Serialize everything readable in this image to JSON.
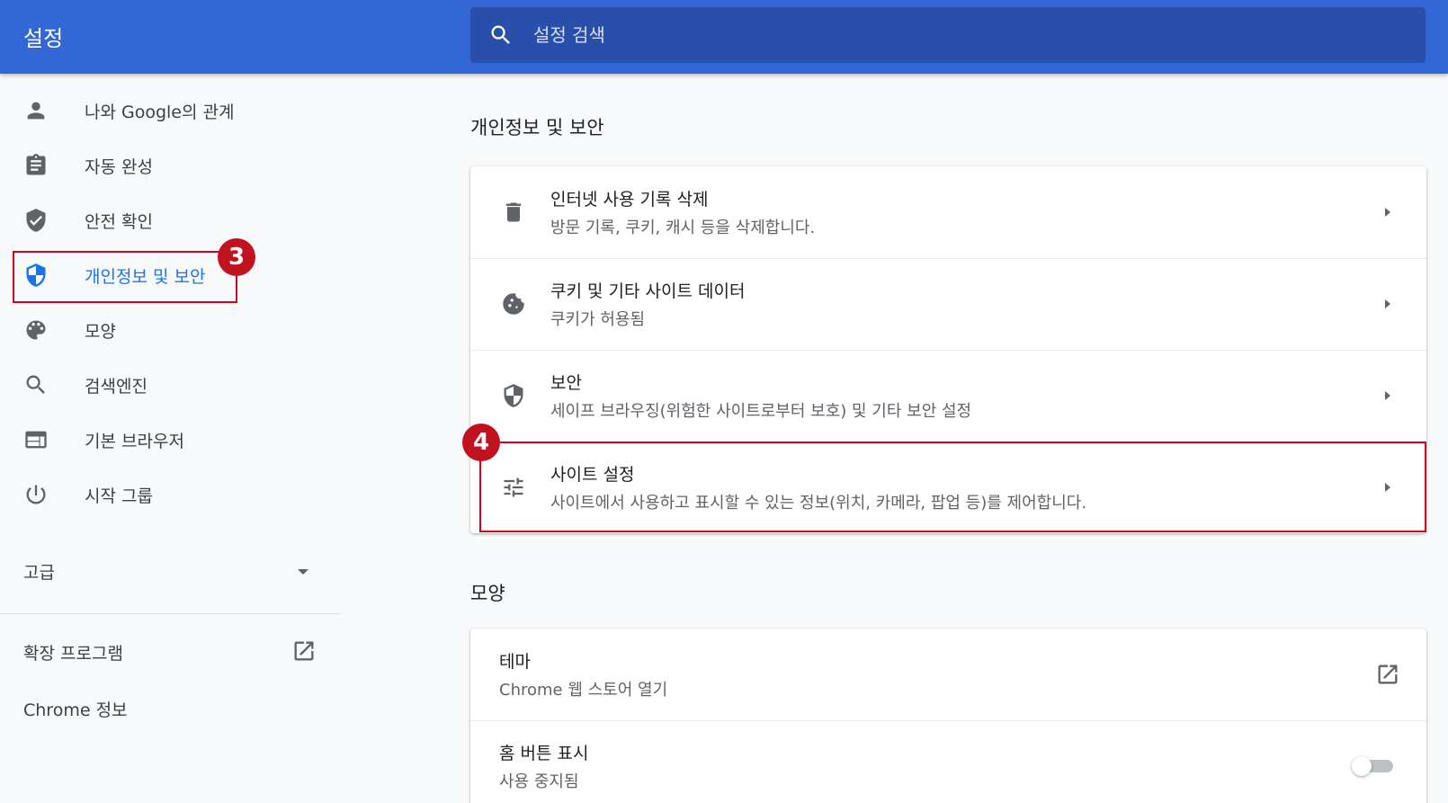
{
  "header": {
    "title": "설정",
    "search_placeholder": "설정 검색",
    "search_icon": "search-icon",
    "bar_color": "#3367d6",
    "search_bg": "#2a4faa"
  },
  "sidebar": {
    "items": [
      {
        "label": "나와 Google의 관계",
        "icon": "person-icon"
      },
      {
        "label": "자동 완성",
        "icon": "clipboard-icon"
      },
      {
        "label": "안전 확인",
        "icon": "shield-check-icon"
      },
      {
        "label": "개인정보 및 보안",
        "icon": "shield-privacy-icon",
        "active": true
      },
      {
        "label": "모양",
        "icon": "palette-icon"
      },
      {
        "label": "검색엔진",
        "icon": "search-icon"
      },
      {
        "label": "기본 브라우저",
        "icon": "browser-icon"
      },
      {
        "label": "시작 그룹",
        "icon": "power-icon"
      }
    ],
    "advanced_label": "고급",
    "extensions_label": "확장 프로그램",
    "about_label": "Chrome 정보",
    "active_color": "#1a73e8"
  },
  "annotations": {
    "badge_3": "3",
    "badge_4": "4",
    "color": "#c1121f"
  },
  "privacy": {
    "section_title": "개인정보 및 보안",
    "rows": [
      {
        "title": "인터넷 사용 기록 삭제",
        "subtitle": "방문 기록, 쿠키, 캐시 등을 삭제합니다.",
        "icon": "trash-icon"
      },
      {
        "title": "쿠키 및 기타 사이트 데이터",
        "subtitle": "쿠키가 허용됨",
        "icon": "cookie-icon"
      },
      {
        "title": "보안",
        "subtitle": "세이프 브라우징(위험한 사이트로부터 보호) 및 기타 보안 설정",
        "icon": "shield-icon"
      },
      {
        "title": "사이트 설정",
        "subtitle": "사이트에서 사용하고 표시할 수 있는 정보(위치, 카메라, 팝업 등)를 제어합니다.",
        "icon": "tune-icon"
      }
    ]
  },
  "appearance": {
    "section_title": "모양",
    "theme_title": "테마",
    "theme_subtitle": "Chrome 웹 스토어 열기",
    "home_title": "홈 버튼 표시",
    "home_subtitle": "사용 중지됨",
    "home_enabled": false
  }
}
